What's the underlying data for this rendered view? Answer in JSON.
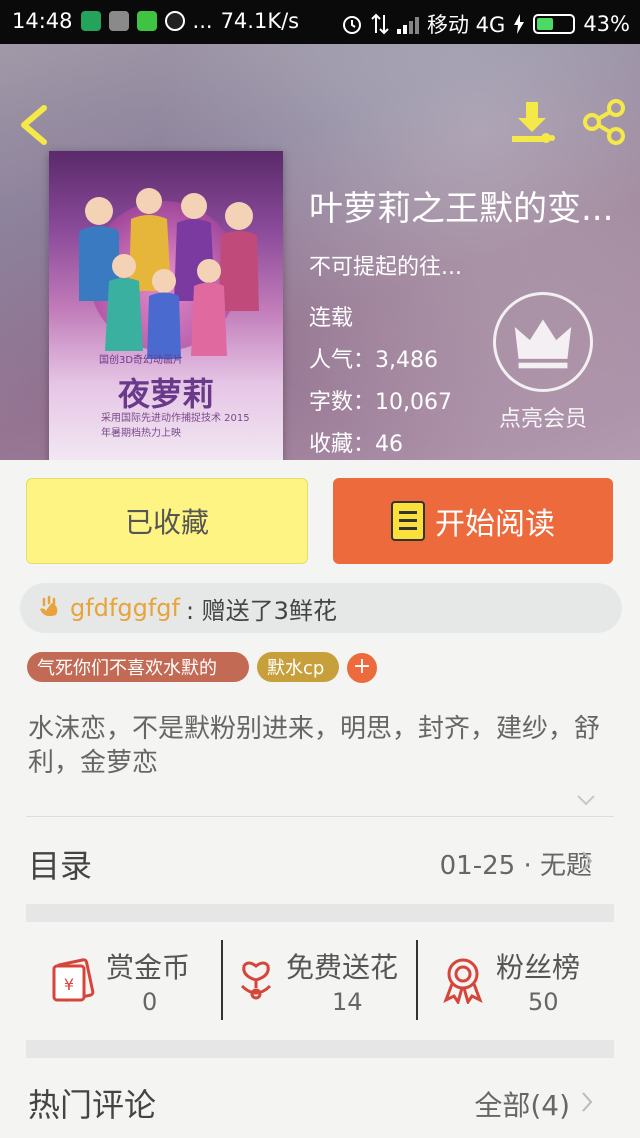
{
  "status_bar": {
    "time": "14:48",
    "dots": "...",
    "speed": "74.1K/s",
    "carrier": "移动 4G",
    "battery": "43%"
  },
  "book": {
    "title": "叶萝莉之王默的变...",
    "subtitle": "不可提起的往...",
    "status": "连载",
    "popularity": "人气：3,486",
    "words": "字数：10,067",
    "favorites": "收藏：46",
    "cover_title": "夜萝莉",
    "cover_caption": "国创3D奇幻动画片",
    "cover_line": "采用国际先进动作捕捉技术 2015年暑期档热力上映"
  },
  "vip": {
    "label": "点亮会员"
  },
  "actions": {
    "fav_label": "已收藏",
    "read_label": "开始阅读"
  },
  "flower": {
    "user": "gfdfggfgf",
    "text": ": 赠送了3鲜花"
  },
  "tags": [
    {
      "label": "气死你们不喜欢水默的",
      "color": "#c36a55"
    },
    {
      "label": "默水cp",
      "color": "#c7a03c"
    }
  ],
  "tag_add": "+",
  "description": "水沫恋，不是默粉别进来，明思，封齐，建纱，舒利，金萝恋",
  "toc": {
    "title": "目录",
    "latest": "01-25 · 无题"
  },
  "stats": [
    {
      "label": "赏金币",
      "value": "0"
    },
    {
      "label": "免费送花",
      "value": "14"
    },
    {
      "label": "粉丝榜",
      "value": "50"
    }
  ],
  "comments": {
    "title": "热门评论",
    "all": "全部(4)"
  },
  "colors": {
    "accent": "#ec6a3c",
    "fav_bg": "#fdf483",
    "flower_user": "#e8a33a"
  }
}
